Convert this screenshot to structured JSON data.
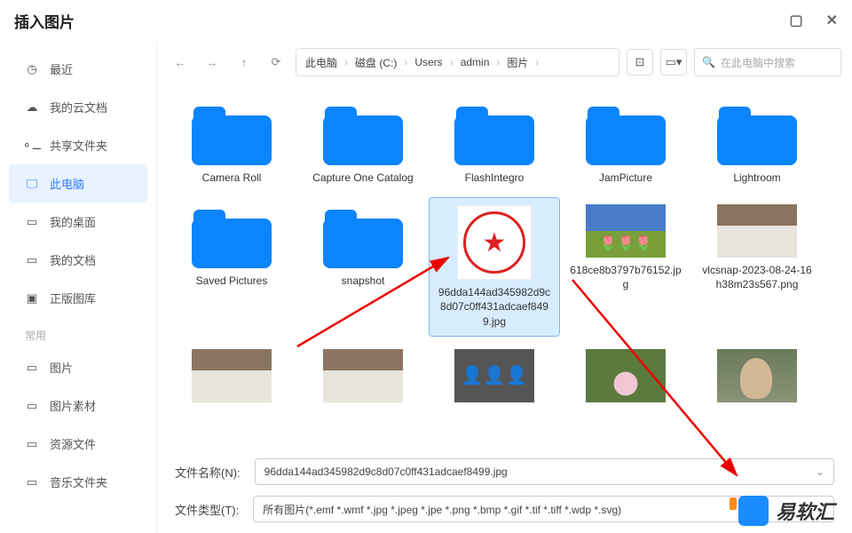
{
  "window": {
    "title": "插入图片"
  },
  "breadcrumb": {
    "parts": [
      "此电脑",
      "磁盘 (C:)",
      "Users",
      "admin",
      "图片"
    ]
  },
  "search": {
    "placeholder": "在此电脑中搜索"
  },
  "sidebar": {
    "section_label": "常用",
    "items": [
      {
        "label": "最近",
        "icon": "clock"
      },
      {
        "label": "我的云文档",
        "icon": "cloud"
      },
      {
        "label": "共享文件夹",
        "icon": "share"
      },
      {
        "label": "此电脑",
        "icon": "monitor",
        "active": true
      },
      {
        "label": "我的桌面",
        "icon": "folder"
      },
      {
        "label": "我的文档",
        "icon": "folder"
      },
      {
        "label": "正版图库",
        "icon": "image"
      }
    ],
    "common_items": [
      {
        "label": "图片"
      },
      {
        "label": "图片素材"
      },
      {
        "label": "资源文件"
      },
      {
        "label": "音乐文件夹"
      }
    ]
  },
  "files": {
    "row1": [
      {
        "type": "folder",
        "label": "Camera Roll"
      },
      {
        "type": "folder",
        "label": "Capture One Catalog"
      },
      {
        "type": "folder",
        "label": "FlashIntegro"
      },
      {
        "type": "folder",
        "label": "JamPicture"
      },
      {
        "type": "folder",
        "label": "Lightroom"
      }
    ],
    "row2": [
      {
        "type": "folder",
        "label": "Saved Pictures"
      },
      {
        "type": "folder",
        "label": "snapshot"
      },
      {
        "type": "image",
        "label": "96dda144ad345982d9c8d07c0ff431adcaef8499.jpg",
        "thumb": "seal",
        "selected": true
      },
      {
        "type": "image",
        "label": "618ce8b3797b76152.jpg",
        "thumb": "tulips"
      },
      {
        "type": "image",
        "label": "vlcsnap-2023-08-24-16h38m23s567.png",
        "thumb": "bedroom"
      }
    ],
    "row3": [
      {
        "type": "image",
        "label": "",
        "thumb": "bedroom"
      },
      {
        "type": "image",
        "label": "",
        "thumb": "bedroom"
      },
      {
        "type": "image",
        "label": "",
        "thumb": "people"
      },
      {
        "type": "image",
        "label": "",
        "thumb": "lotus"
      },
      {
        "type": "image",
        "label": "",
        "thumb": "portrait"
      }
    ]
  },
  "form": {
    "filename_label": "文件名称(N):",
    "filename_value": "96dda144ad345982d9c8d07c0ff431adcaef8499.jpg",
    "filetype_label": "文件类型(T):",
    "filetype_value": "所有图片(*.emf *.wmf *.jpg *.jpeg *.jpe *.png *.bmp *.gif *.tif *.tiff *.wdp *.svg)"
  },
  "watermark": {
    "text": "易软汇"
  }
}
